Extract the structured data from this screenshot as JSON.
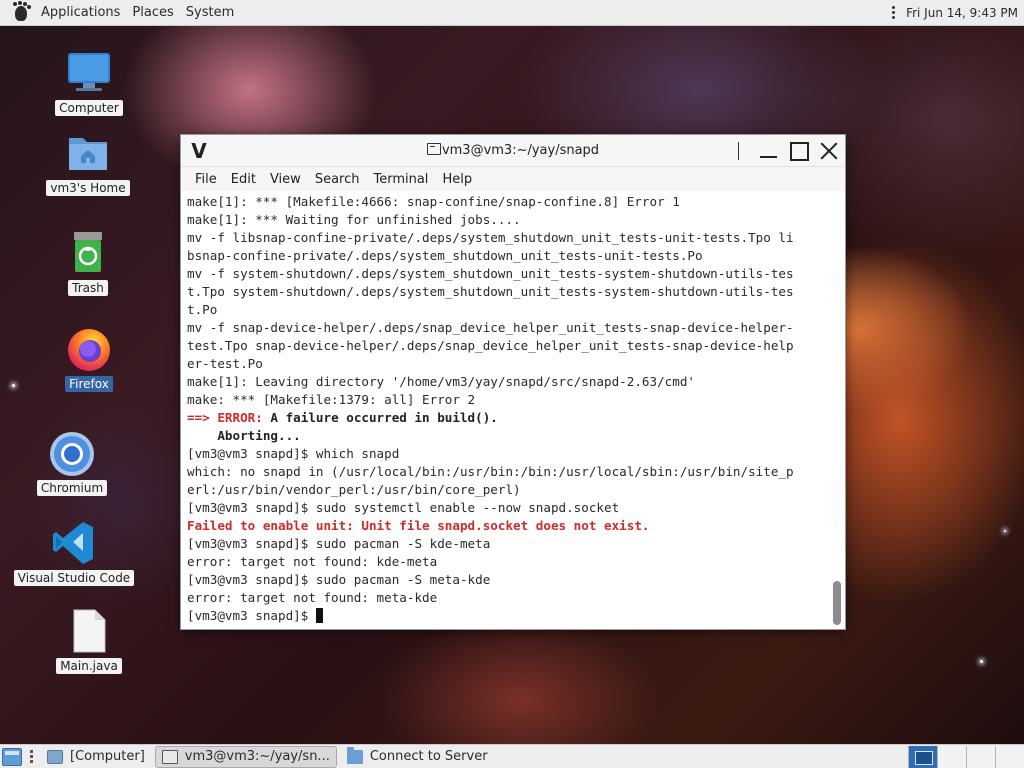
{
  "top_panel": {
    "menus": [
      "Applications",
      "Places",
      "System"
    ],
    "clock": "Fri Jun 14,  9:43 PM"
  },
  "desktop_icons": [
    {
      "label": "Computer",
      "icon": "computer-icon"
    },
    {
      "label": "vm3's Home",
      "icon": "home-folder-icon"
    },
    {
      "label": "Trash",
      "icon": "trash-icon"
    },
    {
      "label": "Firefox",
      "icon": "firefox-icon",
      "selected": true
    },
    {
      "label": "Chromium",
      "icon": "chromium-icon"
    },
    {
      "label": "Visual Studio Code",
      "icon": "vscode-icon"
    },
    {
      "label": "Main.java",
      "icon": "text-file-icon"
    }
  ],
  "terminal": {
    "title": "vm3@vm3:~/yay/snapd",
    "menus": [
      "File",
      "Edit",
      "View",
      "Search",
      "Terminal",
      "Help"
    ],
    "lines": [
      {
        "text": "make[1]: *** [Makefile:4666: snap-confine/snap-confine.8] Error 1"
      },
      {
        "text": "make[1]: *** Waiting for unfinished jobs...."
      },
      {
        "text": "mv -f libsnap-confine-private/.deps/system_shutdown_unit_tests-unit-tests.Tpo li"
      },
      {
        "text": "bsnap-confine-private/.deps/system_shutdown_unit_tests-unit-tests.Po"
      },
      {
        "text": "mv -f system-shutdown/.deps/system_shutdown_unit_tests-system-shutdown-utils-tes"
      },
      {
        "text": "t.Tpo system-shutdown/.deps/system_shutdown_unit_tests-system-shutdown-utils-tes"
      },
      {
        "text": "t.Po"
      },
      {
        "text": "mv -f snap-device-helper/.deps/snap_device_helper_unit_tests-snap-device-helper-"
      },
      {
        "text": "test.Tpo snap-device-helper/.deps/snap_device_helper_unit_tests-snap-device-help"
      },
      {
        "text": "er-test.Po"
      },
      {
        "text": "make[1]: Leaving directory '/home/vm3/yay/snapd/src/snapd-2.63/cmd'"
      },
      {
        "text": "make: *** [Makefile:1379: all] Error 2"
      },
      {
        "prefix": "==> ERROR:",
        "text": " A failure occurred in build().",
        "style": "error-prefix"
      },
      {
        "text": "    Aborting...",
        "style": "bold"
      },
      {
        "text": "[vm3@vm3 snapd]$ which snapd"
      },
      {
        "text": "which: no snapd in (/usr/local/bin:/usr/bin:/bin:/usr/local/sbin:/usr/bin/site_p"
      },
      {
        "text": "erl:/usr/bin/vendor_perl:/usr/bin/core_perl)"
      },
      {
        "text": "[vm3@vm3 snapd]$ sudo systemctl enable --now snapd.socket"
      },
      {
        "text": "Failed to enable unit: Unit file snapd.socket does not exist.",
        "style": "error"
      },
      {
        "text": "[vm3@vm3 snapd]$ sudo pacman -S kde-meta"
      },
      {
        "text": "error: target not found: kde-meta"
      },
      {
        "text": "[vm3@vm3 snapd]$ sudo pacman -S meta-kde"
      },
      {
        "text": "error: target not found: meta-kde"
      },
      {
        "text": "[vm3@vm3 snapd]$ ",
        "cursor": true
      }
    ]
  },
  "bottom_panel": {
    "tasks": [
      {
        "label": "[Computer]",
        "icon": "computer-icon",
        "active": false
      },
      {
        "label": "vm3@vm3:~/yay/sn...",
        "icon": "terminal-icon",
        "active": true
      },
      {
        "label": "Connect to Server",
        "icon": "folder-icon",
        "active": false
      }
    ],
    "workspaces": 4,
    "active_workspace": 1
  },
  "colors": {
    "panel_bg": "#ededed",
    "error_red": "#d12a2a",
    "selection_blue": "#3465a4"
  }
}
